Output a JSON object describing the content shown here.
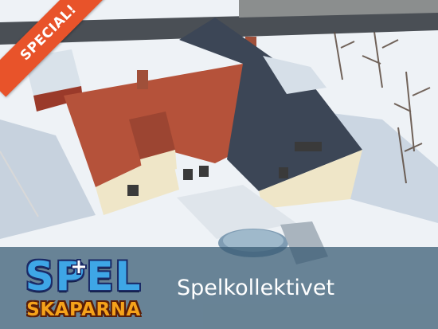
{
  "badge": {
    "label": "SPECIAL!",
    "color": "#e8532a"
  },
  "logo": {
    "line1": "SPEL",
    "line2": "SKAPARNA"
  },
  "title": "Spelkollektivet",
  "colors": {
    "banner": "#345870",
    "roof_tile": "#b5523a",
    "roof_slate": "#3c4656",
    "walls": "#efe6c8",
    "snow": "#eef2f6"
  }
}
